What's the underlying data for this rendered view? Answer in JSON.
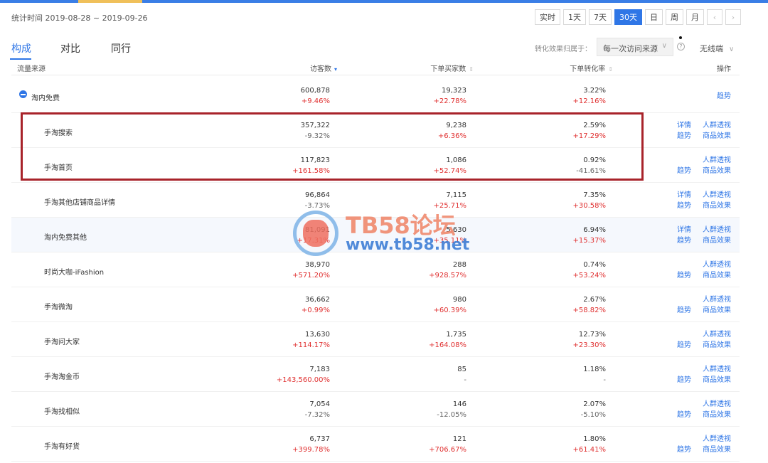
{
  "header": {
    "date_range": "统计时间 2019-08-28 ~ 2019-09-26",
    "ranges": [
      "实时",
      "1天",
      "7天",
      "30天",
      "日",
      "周",
      "月"
    ],
    "active_range": "30天",
    "prev_icon": "chevron-left-icon",
    "next_icon": "chevron-right-icon"
  },
  "tabs": [
    "构成",
    "对比",
    "同行"
  ],
  "active_tab": "构成",
  "filters": {
    "conversion_label": "转化效果归属于：",
    "conversion_value": "每一次访问来源",
    "device_value": "无线端"
  },
  "columns": {
    "source": "流量来源",
    "visitors": "访客数",
    "buyers": "下单买家数",
    "conversion": "下单转化率",
    "ops": "操作"
  },
  "rows": [
    {
      "name": "淘内免费",
      "visitors": "600,878",
      "visitors_change": "+9.46%",
      "buyers": "19,323",
      "buyers_change": "+22.78%",
      "conv": "3.22%",
      "conv_change": "+12.16%",
      "ops": [
        "趋势"
      ]
    },
    {
      "name": "手淘搜索",
      "visitors": "357,322",
      "visitors_change": "-9.32%",
      "buyers": "9,238",
      "buyers_change": "+6.36%",
      "conv": "2.59%",
      "conv_change": "+17.29%",
      "ops": [
        "详情",
        "人群透视",
        "趋势",
        "商品效果"
      ]
    },
    {
      "name": "手淘首页",
      "visitors": "117,823",
      "visitors_change": "+161.58%",
      "buyers": "1,086",
      "buyers_change": "+52.74%",
      "conv": "0.92%",
      "conv_change": "-41.61%",
      "ops": [
        "人群透视",
        "趋势",
        "商品效果"
      ]
    },
    {
      "name": "手淘其他店铺商品详情",
      "visitors": "96,864",
      "visitors_change": "-3.73%",
      "buyers": "7,115",
      "buyers_change": "+25.71%",
      "conv": "7.35%",
      "conv_change": "+30.58%",
      "ops": [
        "详情",
        "人群透视",
        "趋势",
        "商品效果"
      ]
    },
    {
      "name": "淘内免费其他",
      "visitors": "81,091",
      "visitors_change": "+17.31%",
      "buyers": "5,630",
      "buyers_change": "+35.11%",
      "conv": "6.94%",
      "conv_change": "+15.37%",
      "ops": [
        "详情",
        "人群透视",
        "趋势",
        "商品效果"
      ]
    },
    {
      "name": "时尚大咖-iFashion",
      "visitors": "38,970",
      "visitors_change": "+571.20%",
      "buyers": "288",
      "buyers_change": "+928.57%",
      "conv": "0.74%",
      "conv_change": "+53.24%",
      "ops": [
        "人群透视",
        "趋势",
        "商品效果"
      ]
    },
    {
      "name": "手淘微淘",
      "visitors": "36,662",
      "visitors_change": "+0.99%",
      "buyers": "980",
      "buyers_change": "+60.39%",
      "conv": "2.67%",
      "conv_change": "+58.82%",
      "ops": [
        "人群透视",
        "趋势",
        "商品效果"
      ]
    },
    {
      "name": "手淘问大家",
      "visitors": "13,630",
      "visitors_change": "+114.17%",
      "buyers": "1,735",
      "buyers_change": "+164.08%",
      "conv": "12.73%",
      "conv_change": "+23.30%",
      "ops": [
        "人群透视",
        "趋势",
        "商品效果"
      ]
    },
    {
      "name": "手淘淘金币",
      "visitors": "7,183",
      "visitors_change": "+143,560.00%",
      "buyers": "85",
      "buyers_change": "-",
      "conv": "1.18%",
      "conv_change": "-",
      "ops": [
        "人群透视",
        "趋势",
        "商品效果"
      ]
    },
    {
      "name": "手淘找相似",
      "visitors": "7,054",
      "visitors_change": "-7.32%",
      "buyers": "146",
      "buyers_change": "-12.05%",
      "conv": "2.07%",
      "conv_change": "-5.10%",
      "ops": [
        "人群透视",
        "趋势",
        "商品效果"
      ]
    },
    {
      "name": "手淘有好货",
      "visitors": "6,737",
      "visitors_change": "+399.78%",
      "buyers": "121",
      "buyers_change": "+706.67%",
      "conv": "1.80%",
      "conv_change": "+61.41%",
      "ops": [
        "人群透视",
        "趋势",
        "商品效果"
      ]
    }
  ],
  "watermark": {
    "title": "TB58论坛",
    "url": "www.tb58.net"
  },
  "colors": {
    "accent": "#2f76e6",
    "up": "#e03131",
    "highlight_box": "#a8232a"
  }
}
